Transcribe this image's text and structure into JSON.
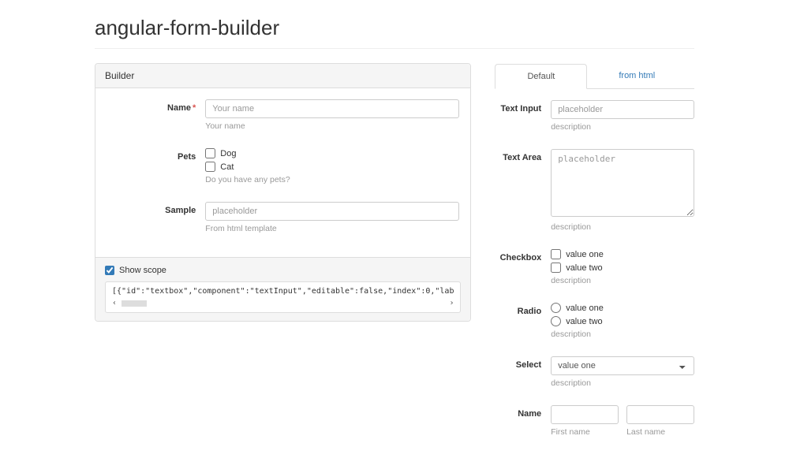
{
  "title": "angular-form-builder",
  "builder": {
    "heading": "Builder",
    "fields": {
      "name": {
        "label": "Name",
        "placeholder": "Your name",
        "help": "Your name",
        "required": true
      },
      "pets": {
        "label": "Pets",
        "options": [
          "Dog",
          "Cat"
        ],
        "help": "Do you have any pets?"
      },
      "sample": {
        "label": "Sample",
        "placeholder": "placeholder",
        "help": "From html template"
      }
    },
    "scope": {
      "checkbox_label": "Show scope",
      "checked": true,
      "code": "[{\"id\":\"textbox\",\"component\":\"textInput\",\"editable\":false,\"index\":0,\"lab"
    }
  },
  "preview": {
    "tabs": {
      "default": "Default",
      "from_html": "from html"
    },
    "text_input": {
      "label": "Text Input",
      "placeholder": "placeholder",
      "help": "description"
    },
    "text_area": {
      "label": "Text Area",
      "placeholder": "placeholder",
      "help": "description"
    },
    "checkbox": {
      "label": "Checkbox",
      "options": [
        "value one",
        "value two"
      ],
      "help": "description"
    },
    "radio": {
      "label": "Radio",
      "options": [
        "value one",
        "value two"
      ],
      "help": "description"
    },
    "select": {
      "label": "Select",
      "selected": "value one",
      "help": "description"
    },
    "name": {
      "label": "Name",
      "first_help": "First name",
      "last_help": "Last name"
    }
  }
}
